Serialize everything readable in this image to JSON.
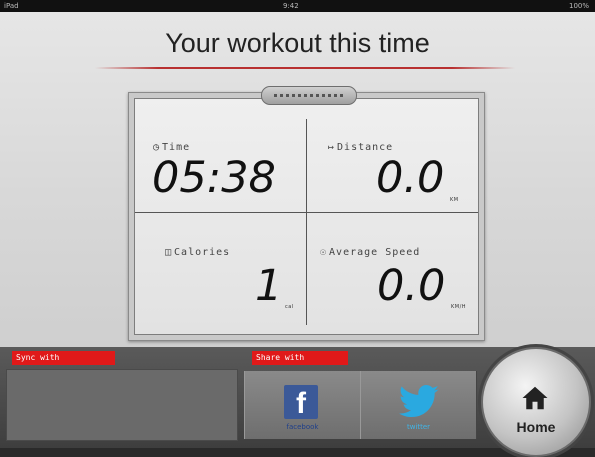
{
  "status_bar": {
    "left": "iPad",
    "center": "9:42",
    "right": "100%"
  },
  "title": "Your workout this time",
  "stats": {
    "time": {
      "label": "Time",
      "value": "05:38",
      "unit": ""
    },
    "distance": {
      "label": "Distance",
      "value": "0.0",
      "unit": "KM"
    },
    "calories": {
      "label": "Calories",
      "value": "1",
      "unit": "cal"
    },
    "speed": {
      "label": "Average Speed",
      "value": "0.0",
      "unit": "KM/H"
    }
  },
  "sync_label": "Sync with",
  "share_label": "Share with",
  "share": {
    "facebook": "facebook",
    "twitter": "twitter"
  },
  "home_label": "Home",
  "colors": {
    "accent_red": "#e01919",
    "facebook_blue": "#3b5998",
    "twitter_blue": "#2aa9e0",
    "title_rule": "#b83030"
  },
  "icons": [
    "clock-icon",
    "distance-icon",
    "calories-icon",
    "speed-icon",
    "facebook-icon",
    "twitter-icon",
    "home-icon"
  ]
}
